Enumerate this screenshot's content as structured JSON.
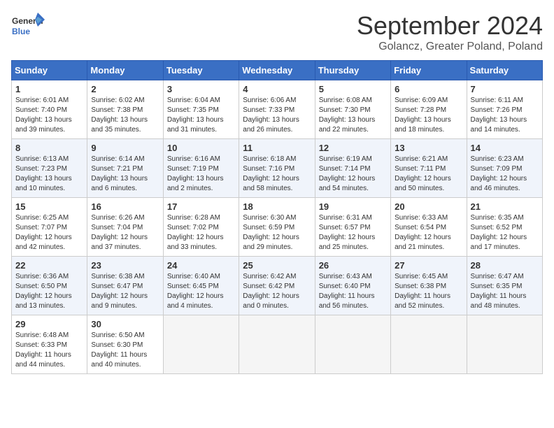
{
  "logo": {
    "text_line1": "General",
    "text_line2": "Blue"
  },
  "title": "September 2024",
  "location": "Golancz, Greater Poland, Poland",
  "weekdays": [
    "Sunday",
    "Monday",
    "Tuesday",
    "Wednesday",
    "Thursday",
    "Friday",
    "Saturday"
  ],
  "weeks": [
    [
      {
        "day": "1",
        "sunrise": "6:01 AM",
        "sunset": "7:40 PM",
        "daylight": "13 hours and 39 minutes."
      },
      {
        "day": "2",
        "sunrise": "6:02 AM",
        "sunset": "7:38 PM",
        "daylight": "13 hours and 35 minutes."
      },
      {
        "day": "3",
        "sunrise": "6:04 AM",
        "sunset": "7:35 PM",
        "daylight": "13 hours and 31 minutes."
      },
      {
        "day": "4",
        "sunrise": "6:06 AM",
        "sunset": "7:33 PM",
        "daylight": "13 hours and 26 minutes."
      },
      {
        "day": "5",
        "sunrise": "6:08 AM",
        "sunset": "7:30 PM",
        "daylight": "13 hours and 22 minutes."
      },
      {
        "day": "6",
        "sunrise": "6:09 AM",
        "sunset": "7:28 PM",
        "daylight": "13 hours and 18 minutes."
      },
      {
        "day": "7",
        "sunrise": "6:11 AM",
        "sunset": "7:26 PM",
        "daylight": "13 hours and 14 minutes."
      }
    ],
    [
      {
        "day": "8",
        "sunrise": "6:13 AM",
        "sunset": "7:23 PM",
        "daylight": "13 hours and 10 minutes."
      },
      {
        "day": "9",
        "sunrise": "6:14 AM",
        "sunset": "7:21 PM",
        "daylight": "13 hours and 6 minutes."
      },
      {
        "day": "10",
        "sunrise": "6:16 AM",
        "sunset": "7:19 PM",
        "daylight": "13 hours and 2 minutes."
      },
      {
        "day": "11",
        "sunrise": "6:18 AM",
        "sunset": "7:16 PM",
        "daylight": "12 hours and 58 minutes."
      },
      {
        "day": "12",
        "sunrise": "6:19 AM",
        "sunset": "7:14 PM",
        "daylight": "12 hours and 54 minutes."
      },
      {
        "day": "13",
        "sunrise": "6:21 AM",
        "sunset": "7:11 PM",
        "daylight": "12 hours and 50 minutes."
      },
      {
        "day": "14",
        "sunrise": "6:23 AM",
        "sunset": "7:09 PM",
        "daylight": "12 hours and 46 minutes."
      }
    ],
    [
      {
        "day": "15",
        "sunrise": "6:25 AM",
        "sunset": "7:07 PM",
        "daylight": "12 hours and 42 minutes."
      },
      {
        "day": "16",
        "sunrise": "6:26 AM",
        "sunset": "7:04 PM",
        "daylight": "12 hours and 37 minutes."
      },
      {
        "day": "17",
        "sunrise": "6:28 AM",
        "sunset": "7:02 PM",
        "daylight": "12 hours and 33 minutes."
      },
      {
        "day": "18",
        "sunrise": "6:30 AM",
        "sunset": "6:59 PM",
        "daylight": "12 hours and 29 minutes."
      },
      {
        "day": "19",
        "sunrise": "6:31 AM",
        "sunset": "6:57 PM",
        "daylight": "12 hours and 25 minutes."
      },
      {
        "day": "20",
        "sunrise": "6:33 AM",
        "sunset": "6:54 PM",
        "daylight": "12 hours and 21 minutes."
      },
      {
        "day": "21",
        "sunrise": "6:35 AM",
        "sunset": "6:52 PM",
        "daylight": "12 hours and 17 minutes."
      }
    ],
    [
      {
        "day": "22",
        "sunrise": "6:36 AM",
        "sunset": "6:50 PM",
        "daylight": "12 hours and 13 minutes."
      },
      {
        "day": "23",
        "sunrise": "6:38 AM",
        "sunset": "6:47 PM",
        "daylight": "12 hours and 9 minutes."
      },
      {
        "day": "24",
        "sunrise": "6:40 AM",
        "sunset": "6:45 PM",
        "daylight": "12 hours and 4 minutes."
      },
      {
        "day": "25",
        "sunrise": "6:42 AM",
        "sunset": "6:42 PM",
        "daylight": "12 hours and 0 minutes."
      },
      {
        "day": "26",
        "sunrise": "6:43 AM",
        "sunset": "6:40 PM",
        "daylight": "11 hours and 56 minutes."
      },
      {
        "day": "27",
        "sunrise": "6:45 AM",
        "sunset": "6:38 PM",
        "daylight": "11 hours and 52 minutes."
      },
      {
        "day": "28",
        "sunrise": "6:47 AM",
        "sunset": "6:35 PM",
        "daylight": "11 hours and 48 minutes."
      }
    ],
    [
      {
        "day": "29",
        "sunrise": "6:48 AM",
        "sunset": "6:33 PM",
        "daylight": "11 hours and 44 minutes."
      },
      {
        "day": "30",
        "sunrise": "6:50 AM",
        "sunset": "6:30 PM",
        "daylight": "11 hours and 40 minutes."
      },
      null,
      null,
      null,
      null,
      null
    ]
  ]
}
